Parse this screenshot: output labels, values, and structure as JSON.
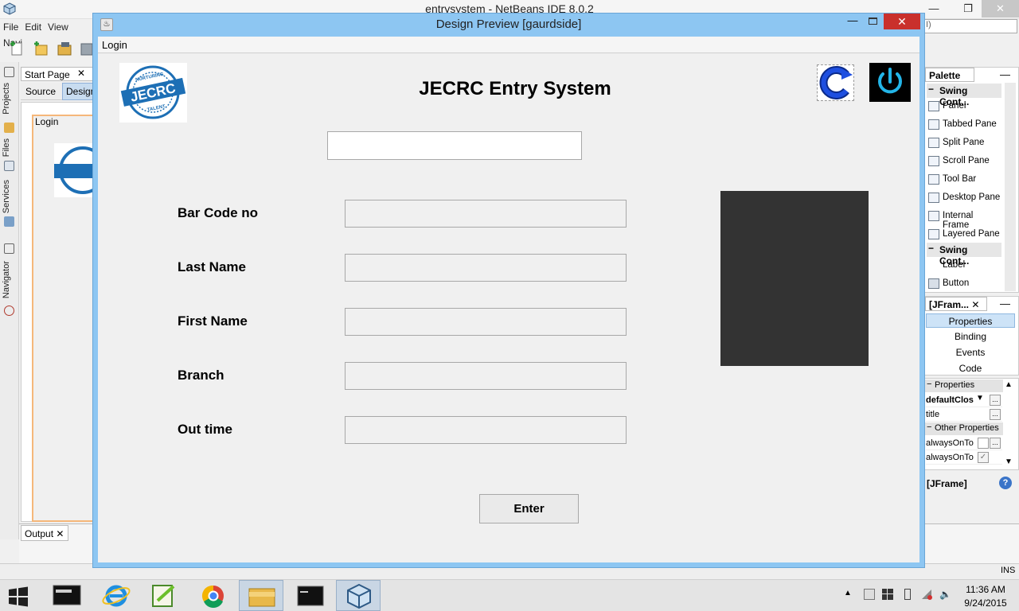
{
  "ide": {
    "title": "entrysystem - NetBeans IDE 8.0.2",
    "menus": [
      "File",
      "Edit",
      "View",
      "Navi"
    ],
    "search_placeholder": "I)",
    "side_tabs": [
      "Projects",
      "Files",
      "Services",
      "Navigator"
    ],
    "editor_tab": "Start Page",
    "source_label": "Source",
    "design_label": "Design",
    "designer_form_title": "Login",
    "output_tab": "Output",
    "status_ins": "INS",
    "palette": {
      "tab": "Palette",
      "categories": [
        "Swing Cont...",
        "Swing Cont..."
      ],
      "containers": [
        "Panel",
        "Tabbed Pane",
        "Split Pane",
        "Scroll Pane",
        "Tool Bar",
        "Desktop Pane",
        "Internal Frame",
        "Layered Pane"
      ],
      "controls": [
        "Label",
        "Button"
      ]
    },
    "navigator": {
      "tab": "[JFram...",
      "items": [
        "Properties",
        "Binding",
        "Events",
        "Code"
      ]
    },
    "properties": {
      "category": "Properties",
      "rows": [
        "defaultClos",
        "title"
      ],
      "other_category": "Other Properties",
      "other_rows": [
        "alwaysOnTo",
        "alwaysOnTo"
      ],
      "footer": "[JFrame]",
      "help": "?"
    }
  },
  "dialog": {
    "title": "Design Preview [gaurdside]",
    "menu_login": "Login",
    "app_title": "JECRC  Entry System",
    "logo_text": "JECRC",
    "logo_ring_top": "NURTURING",
    "logo_ring_bottom": "TALENT",
    "fields": [
      {
        "label": "Bar Code no",
        "value": ""
      },
      {
        "label": "Last Name",
        "value": ""
      },
      {
        "label": "First Name",
        "value": ""
      },
      {
        "label": "Branch",
        "value": ""
      },
      {
        "label": "Out time",
        "value": ""
      }
    ],
    "top_field_value": "",
    "enter_label": "Enter"
  },
  "taskbar": {
    "time": "11:36 AM",
    "date": "9/24/2015",
    "apps": [
      "MySQL",
      "Internet Explorer",
      "Notepad++",
      "Chrome",
      "File Explorer",
      "Command Prompt",
      "NetBeans"
    ]
  },
  "colors": {
    "dialog_frame": "#8dc6f2",
    "close_red": "#c9302c",
    "logo_blue": "#1d6fb5",
    "power_cyan": "#23b5e8",
    "photo_box": "#333333"
  }
}
